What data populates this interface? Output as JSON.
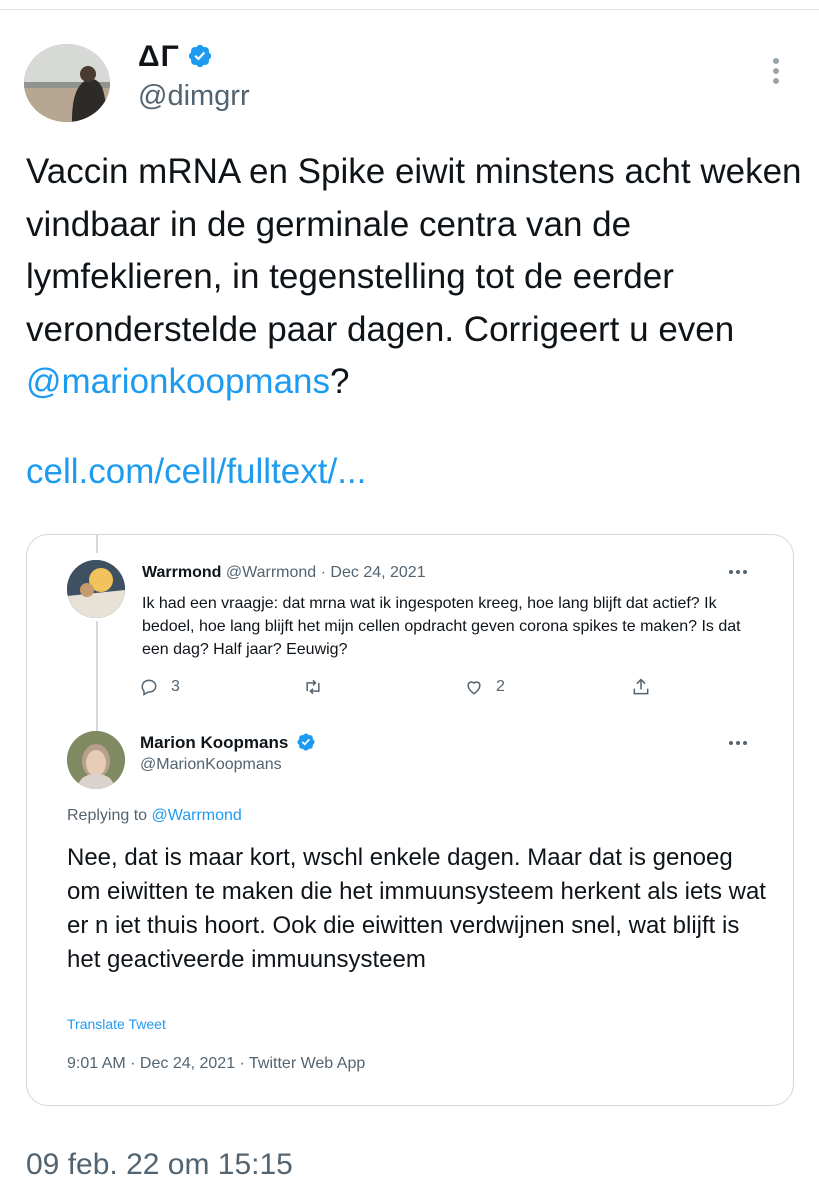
{
  "author": {
    "name": "ΔΓ",
    "handle": "@dimgrr"
  },
  "tweet": {
    "text_main": "Vaccin mRNA en Spike eiwit minstens acht weken vindbaar in de germinale centra van de lymfeklieren, in tegenstelling tot de eerder veronderstelde paar dagen. Corrigeert u even ",
    "mention": "@marionkoopmans",
    "text_end": "?",
    "link": "cell.com/cell/fulltext/..."
  },
  "quoted": {
    "first": {
      "name": "Warrmond",
      "handle": "@Warrmond",
      "sep": "·",
      "date": "Dec 24, 2021",
      "text": "Ik had een vraagje: dat mrna wat ik ingespoten kreeg, hoe lang blijft dat actief? Ik bedoel, hoe lang blijft het mijn cellen opdracht geven corona spikes te maken? Is dat een dag? Half jaar? Eeuwig?",
      "reply_count": "3",
      "like_count": "2"
    },
    "second": {
      "name": "Marion Koopmans",
      "handle": "@MarionKoopmans",
      "replying_prefix": "Replying to ",
      "replying_to": "@Warrmond",
      "text": "Nee, dat is maar kort, wschl enkele dagen. Maar dat is genoeg om eiwitten te maken die het immuunsysteem herkent als iets wat er n iet thuis hoort. Ook die eiwitten verdwijnen snel, wat blijft is het geactiveerde immuunsysteem",
      "translate": "Translate Tweet",
      "meta": "9:01 AM · Dec 24, 2021 · Twitter Web App"
    }
  },
  "footer": {
    "timestamp": "09 feb. 22 om 15:15"
  },
  "colors": {
    "accent": "#1d9bf0",
    "muted": "#536471",
    "text": "#0f1419",
    "border": "#cfd9de"
  },
  "icons": [
    "verified-badge-icon",
    "more-dots-icon",
    "reply-icon",
    "retweet-icon",
    "like-icon",
    "share-icon"
  ]
}
